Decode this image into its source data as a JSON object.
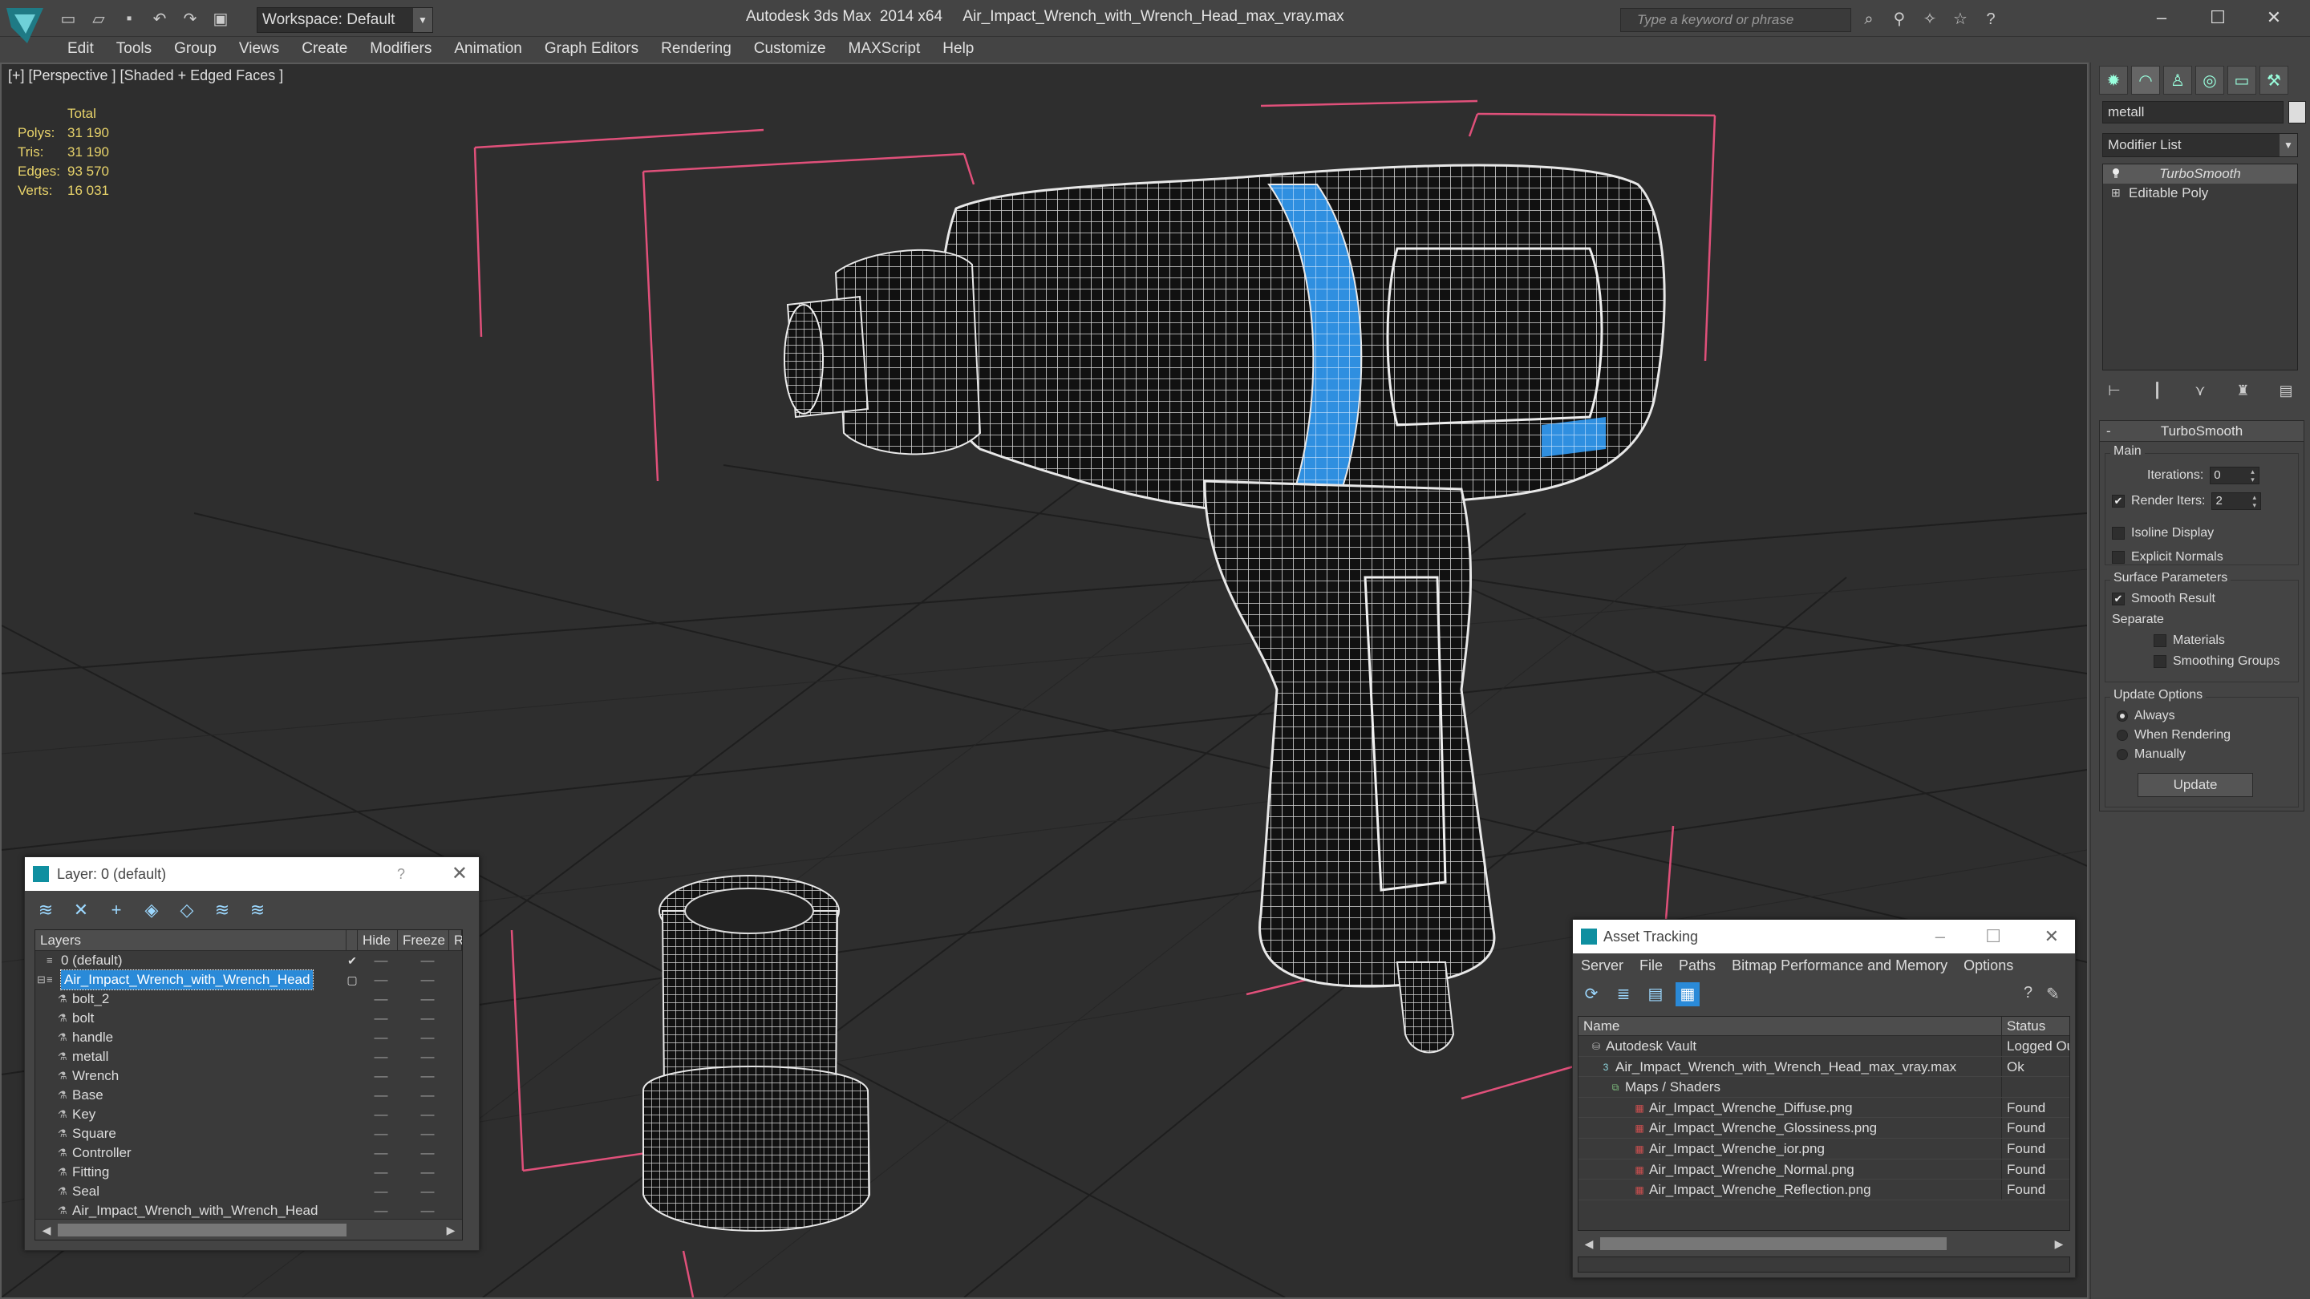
{
  "titlebar": {
    "app_title": "Autodesk 3ds Max  2014 x64",
    "file_name": "Air_Impact_Wrench_with_Wrench_Head_max_vray.max",
    "workspace": "Workspace: Default",
    "search_placeholder": "Type a keyword or phrase"
  },
  "menu": [
    "Edit",
    "Tools",
    "Group",
    "Views",
    "Create",
    "Modifiers",
    "Animation",
    "Graph Editors",
    "Rendering",
    "Customize",
    "MAXScript",
    "Help"
  ],
  "viewport": {
    "label": "[+] [Perspective ] [Shaded + Edged Faces ]",
    "stats": {
      "header": "Total",
      "rows": [
        {
          "label": "Polys:",
          "value": "31 190"
        },
        {
          "label": "Tris:",
          "value": "31 190"
        },
        {
          "label": "Edges:",
          "value": "93 570"
        },
        {
          "label": "Verts:",
          "value": "16 031"
        }
      ]
    }
  },
  "command_panel": {
    "object_name": "metall",
    "modifier_list": "Modifier List",
    "stack": [
      "TurboSmooth",
      "Editable Poly"
    ],
    "rollout_title": "TurboSmooth",
    "main_group": "Main",
    "iterations_label": "Iterations:",
    "iterations_value": "0",
    "render_iters_label": "Render Iters:",
    "render_iters_value": "2",
    "isoline_display": "Isoline Display",
    "explicit_normals": "Explicit Normals",
    "surface_group": "Surface Parameters",
    "smooth_result": "Smooth Result",
    "separate_label": "Separate",
    "materials": "Materials",
    "smoothing_groups": "Smoothing Groups",
    "update_group": "Update Options",
    "always": "Always",
    "when_rendering": "When Rendering",
    "manually": "Manually",
    "update_button": "Update"
  },
  "layer_dialog": {
    "title": "Layer: 0 (default)",
    "help": "?",
    "columns": {
      "layers": "Layers",
      "hide": "Hide",
      "freeze": "Freeze",
      "render": "R"
    },
    "rows": [
      {
        "name": "0 (default)",
        "level": 0,
        "check": "✔"
      },
      {
        "name": "Air_Impact_Wrench_with_Wrench_Head",
        "level": 0,
        "selected": true
      },
      {
        "name": "bolt_2",
        "level": 1
      },
      {
        "name": "bolt",
        "level": 1
      },
      {
        "name": "handle",
        "level": 1
      },
      {
        "name": "metall",
        "level": 1
      },
      {
        "name": "Wrench",
        "level": 1
      },
      {
        "name": "Base",
        "level": 1
      },
      {
        "name": "Key",
        "level": 1
      },
      {
        "name": "Square",
        "level": 1
      },
      {
        "name": "Controller",
        "level": 1
      },
      {
        "name": "Fitting",
        "level": 1
      },
      {
        "name": "Seal",
        "level": 1
      },
      {
        "name": "Air_Impact_Wrench_with_Wrench_Head",
        "level": 1
      }
    ]
  },
  "asset_dialog": {
    "title": "Asset Tracking",
    "menu": [
      "Server",
      "File",
      "Paths",
      "Bitmap Performance and Memory",
      "Options"
    ],
    "columns": {
      "name": "Name",
      "status": "Status"
    },
    "rows": [
      {
        "name": "Autodesk Vault",
        "status": "Logged Out",
        "level": 0,
        "icon": "vault-icon"
      },
      {
        "name": "Air_Impact_Wrench_with_Wrench_Head_max_vray.max",
        "status": "Ok",
        "level": 1,
        "icon": "max-file-icon"
      },
      {
        "name": "Maps / Shaders",
        "status": "",
        "level": 2,
        "icon": "maps-icon"
      },
      {
        "name": "Air_Impact_Wrenche_Diffuse.png",
        "status": "Found",
        "level": 3,
        "icon": "png-icon"
      },
      {
        "name": "Air_Impact_Wrenche_Glossiness.png",
        "status": "Found",
        "level": 3,
        "icon": "png-icon"
      },
      {
        "name": "Air_Impact_Wrenche_ior.png",
        "status": "Found",
        "level": 3,
        "icon": "png-icon"
      },
      {
        "name": "Air_Impact_Wrenche_Normal.png",
        "status": "Found",
        "level": 3,
        "icon": "png-icon"
      },
      {
        "name": "Air_Impact_Wrenche_Reflection.png",
        "status": "Found",
        "level": 3,
        "icon": "png-icon"
      }
    ]
  },
  "colors": {
    "accent_blue": "#2a8ad8",
    "stats_yellow": "#e8d36a",
    "selection_box": "#e0507a",
    "band_blue": "#2f8fe0"
  }
}
